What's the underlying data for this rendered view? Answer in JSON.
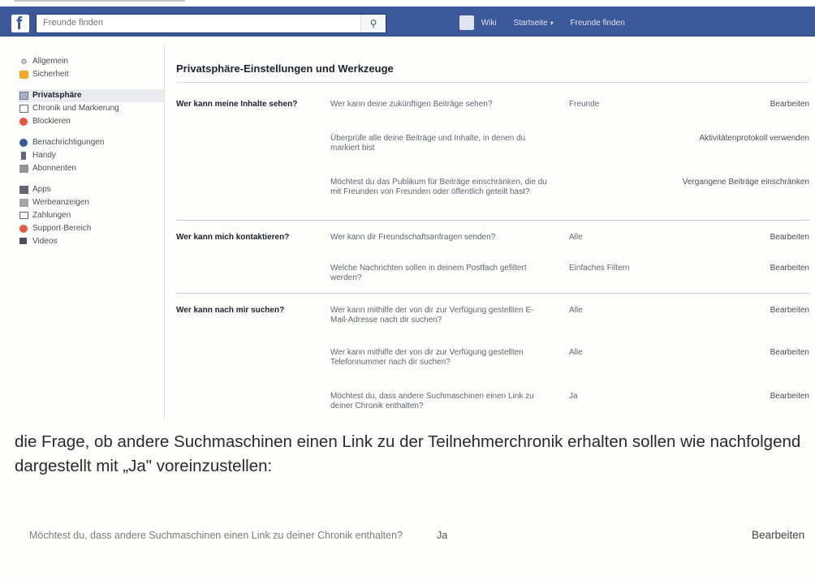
{
  "header": {
    "search_placeholder": "Freunde finden",
    "nav": [
      "Wiki",
      "Startseite",
      "Freunde finden"
    ]
  },
  "sidebar": {
    "items": [
      {
        "label": "Allgemein",
        "icon": "gear-icon"
      },
      {
        "label": "Sicherheit",
        "icon": "lock-icon"
      },
      {
        "label": "Privatsphäre",
        "icon": "privacy-icon",
        "active": true
      },
      {
        "label": "Chronik und Markierung",
        "icon": "chronicle-icon"
      },
      {
        "label": "Blockieren",
        "icon": "block-icon"
      },
      {
        "label": "Benachrichtigungen",
        "icon": "globe-icon"
      },
      {
        "label": "Handy",
        "icon": "phone-icon"
      },
      {
        "label": "Abonnenten",
        "icon": "rss-icon"
      },
      {
        "label": "Apps",
        "icon": "apps-icon"
      },
      {
        "label": "Werbeanzeigen",
        "icon": "ads-icon"
      },
      {
        "label": "Zahlungen",
        "icon": "payments-icon"
      },
      {
        "label": "Support-Bereich",
        "icon": "support-icon"
      },
      {
        "label": "Videos",
        "icon": "video-icon"
      }
    ]
  },
  "main": {
    "title": "Privatsphäre-Einstellungen und Werkzeuge",
    "sections": [
      {
        "label": "Wer kann meine Inhalte sehen?",
        "rows": [
          {
            "question": "Wer kann deine zukünftigen Beiträge sehen?",
            "value": "Freunde",
            "action": "Bearbeiten"
          },
          {
            "question": "Überprüfe alle deine Beiträge und Inhalte, in denen du markiert bist",
            "value": "",
            "action": "Aktivitätenprotokoll verwenden"
          },
          {
            "question": "Möchtest du das Publikum für Beiträge einschränken, die du mit Freunden von Freunden oder öffentlich geteilt hast?",
            "value": "",
            "action": "Vergangene Beiträge einschränken"
          }
        ]
      },
      {
        "label": "Wer kann mich kontaktieren?",
        "rows": [
          {
            "question": "Wer kann dir Freundschaftsanfragen senden?",
            "value": "Alle",
            "action": "Bearbeiten"
          },
          {
            "question": "Welche Nachrichten sollen in deinem Postfach gefiltert werden?",
            "value": "Einfaches Filtern",
            "action": "Bearbeiten"
          }
        ]
      },
      {
        "label": "Wer kann nach mir suchen?",
        "rows": [
          {
            "question": "Wer kann mithilfe der von dir zur Verfügung gestellten E-Mail-Adresse nach dir suchen?",
            "value": "Alle",
            "action": "Bearbeiten"
          },
          {
            "question": "Wer kann mithilfe der von dir zur Verfügung gestellten Telefonnummer nach dir suchen?",
            "value": "Alle",
            "action": "Bearbeiten"
          },
          {
            "question": "Möchtest du, dass andere Suchmaschinen einen Link zu deiner Chronik enthalten?",
            "value": "Ja",
            "action": "Bearbeiten"
          }
        ]
      }
    ]
  },
  "document": {
    "paragraph": "die Frage, ob andere Suchmaschinen einen Link zu der Teilnehmerchronik erhalten sollen wie nachfolgend dargestellt mit „Ja\" voreinzustellen:"
  },
  "example_row": {
    "question": "Möchtest du, dass andere Suchmaschinen einen Link zu deiner Chronik enthalten?",
    "value": "Ja",
    "action": "Bearbeiten"
  }
}
